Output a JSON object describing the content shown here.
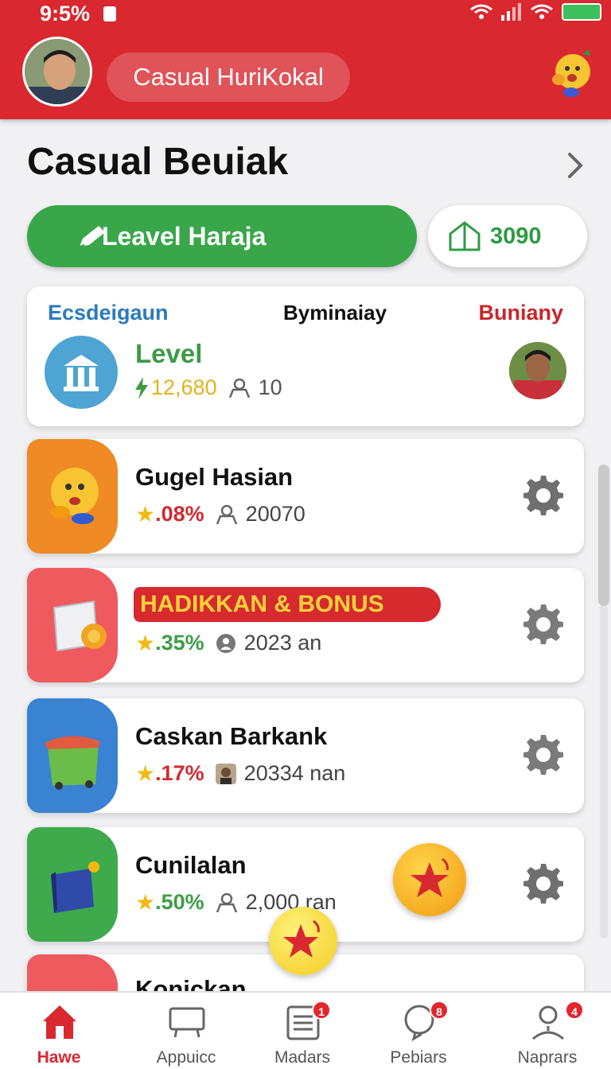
{
  "status_bar": {
    "time": "9:5%"
  },
  "header": {
    "app_title": "Casual HuriKokal"
  },
  "section": {
    "title": "Casual Beuiak"
  },
  "actions": {
    "level_button": "Leavel Haraja",
    "points_value": "3090"
  },
  "stats_card": {
    "tabs": [
      "Ecsdeigaun",
      "Byminaiay",
      "Buniany"
    ],
    "level_label": "Level",
    "amount": "12,680",
    "count": "10"
  },
  "games": [
    {
      "title": "Gugel Hasian",
      "rating": "08%",
      "meta": "20070",
      "thumb_color": "#ef8a24",
      "rating_color": "red"
    },
    {
      "title": "HADIKKAN & BONUS",
      "rating": "35%",
      "meta": "2023 an",
      "thumb_color": "#ee5a5d",
      "rating_color": "green"
    },
    {
      "title": "Caskan Barkank",
      "rating": "17%",
      "meta": "20334 nan",
      "thumb_color": "#3a82d2",
      "rating_color": "red"
    },
    {
      "title": "Cunilalan",
      "rating": "50%",
      "meta": "2,000 ran",
      "thumb_color": "#3eaa4c",
      "rating_color": "green"
    },
    {
      "title": "Konickan",
      "thumb_color": "#ee5a5d"
    }
  ],
  "bottom_nav": [
    {
      "label": "Hawe",
      "active": true
    },
    {
      "label": "Appuicc",
      "active": false
    },
    {
      "label": "Madars",
      "active": false,
      "badge": "1"
    },
    {
      "label": "Pebiars",
      "active": false,
      "badge": "8"
    },
    {
      "label": "Naprars",
      "active": false,
      "badge": "4"
    }
  ],
  "colors": {
    "brand_red": "#d9282f",
    "accent_green": "#39a64a"
  }
}
